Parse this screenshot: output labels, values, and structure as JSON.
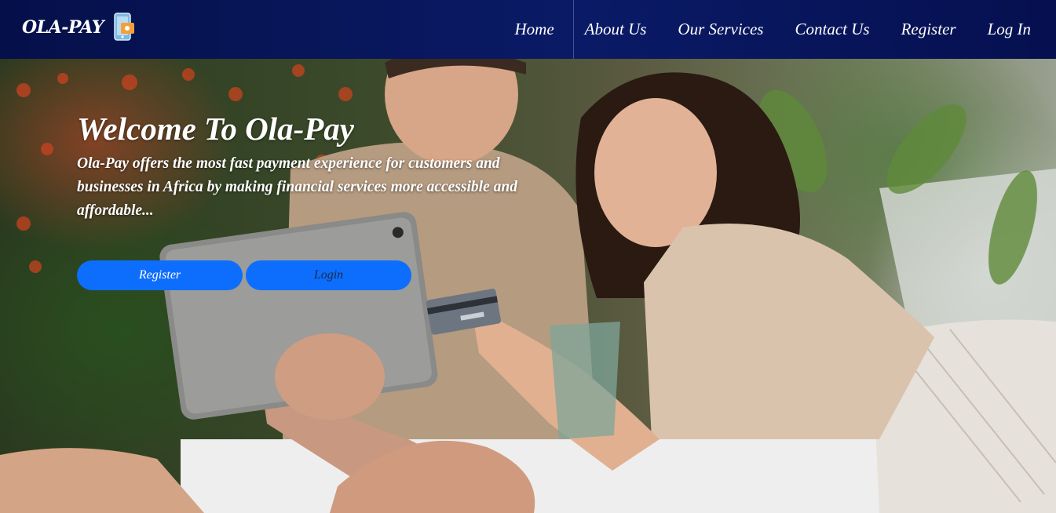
{
  "brand": {
    "name": "OLA-PAY",
    "logo_icon": "phone-wallet-icon"
  },
  "nav": {
    "items": [
      {
        "label": "Home"
      },
      {
        "label": "About Us"
      },
      {
        "label": "Our Services"
      },
      {
        "label": "Contact Us"
      },
      {
        "label": "Register"
      },
      {
        "label": "Log In"
      }
    ]
  },
  "hero": {
    "title": "Welcome To Ola-Pay",
    "subtitle": "Ola-Pay offers the most fast payment experience for customers and businesses in Africa by making financial services more accessible and affordable...",
    "register_label": "Register",
    "login_label": "Login",
    "background_image": "couple-with-tablet-and-card-photo"
  },
  "colors": {
    "navbar": "#0a1a66",
    "button": "#0d6efd",
    "text": "#ffffff"
  }
}
